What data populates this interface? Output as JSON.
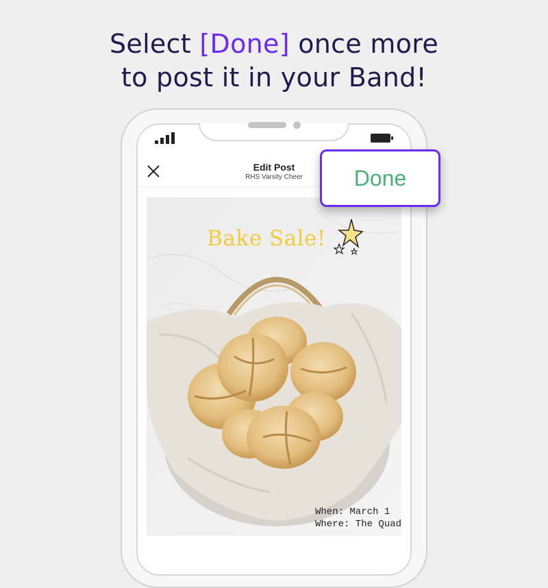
{
  "instruction": {
    "line1_before": "Select ",
    "line1_highlight": "[Done]",
    "line1_after": " once more",
    "line2": "to post it in your Band!"
  },
  "app": {
    "title": "Edit Post",
    "subtitle": "RHS Varsity Cheer",
    "done_label": "Done",
    "close_icon": "close-icon"
  },
  "post": {
    "heading": "Bake Sale!",
    "when": "When: March 1",
    "where": "Where: The Quad"
  },
  "colors": {
    "headline": "#24194f",
    "highlight": "#6a2cf0",
    "done_text": "#4caf7a",
    "bake_title": "#f1cb3a"
  }
}
